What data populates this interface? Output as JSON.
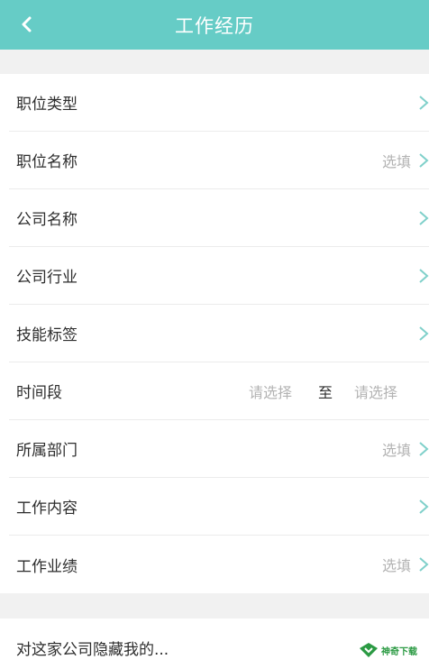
{
  "header": {
    "title": "工作经历",
    "back_icon": "chevron-left-icon",
    "background": "#66ccc6"
  },
  "form": {
    "rows": [
      {
        "label": "职位类型",
        "hint": "",
        "chevron": true
      },
      {
        "label": "职位名称",
        "hint": "选填",
        "chevron": true
      },
      {
        "label": "公司名称",
        "hint": "",
        "chevron": true
      },
      {
        "label": "公司行业",
        "hint": "",
        "chevron": true
      },
      {
        "label": "技能标签",
        "hint": "",
        "chevron": true
      },
      {
        "label": "时间段",
        "from_placeholder": "请选择",
        "separator": "至",
        "to_placeholder": "请选择"
      },
      {
        "label": "所属部门",
        "hint": "选填",
        "chevron": true
      },
      {
        "label": "工作内容",
        "hint": "",
        "chevron": true
      },
      {
        "label": "工作业绩",
        "hint": "选填",
        "chevron": true
      }
    ]
  },
  "privacy": {
    "label": "对这家公司隐藏我的..."
  },
  "watermark": {
    "text": "神奇下载"
  },
  "colors": {
    "accent": "#66ccc6",
    "chevron": "#7fd0ca",
    "hint": "#b3b3b3",
    "text": "#2d2d2d"
  }
}
